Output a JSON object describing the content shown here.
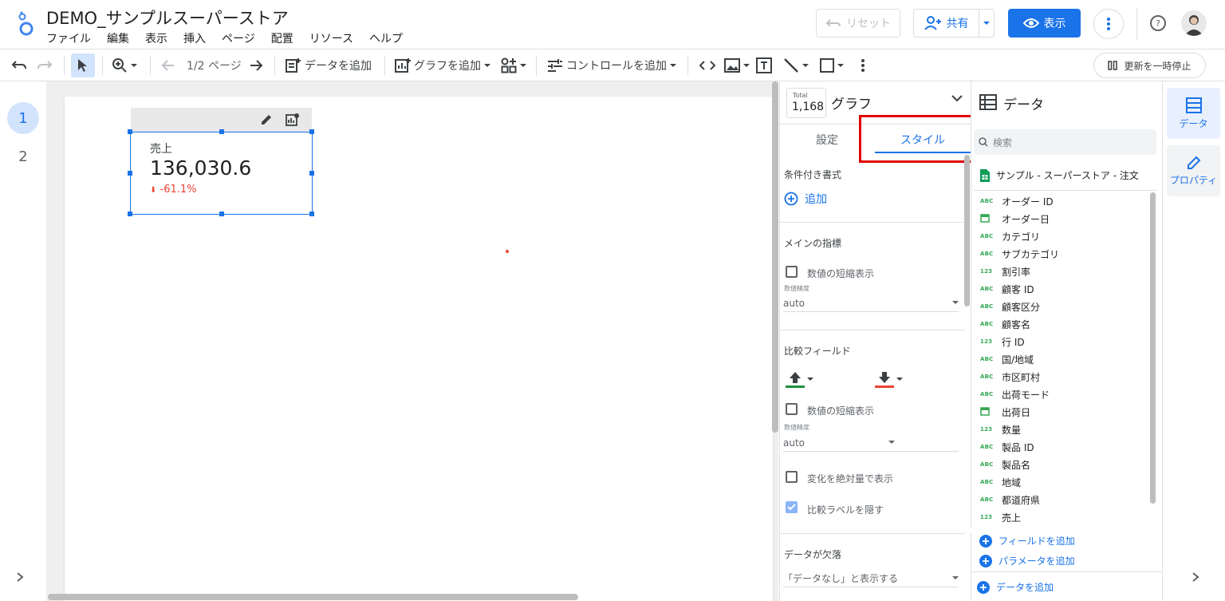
{
  "app": {
    "title": "DEMO_サンプルスーパーストア",
    "menu": [
      "ファイル",
      "編集",
      "表示",
      "挿入",
      "ページ",
      "配置",
      "リソース",
      "ヘルプ"
    ],
    "reset_label": "リセット",
    "share_label": "共有",
    "view_label": "表示"
  },
  "toolbar": {
    "page_indicator": "1/2 ページ",
    "add_data": "データを追加",
    "add_chart": "グラフを追加",
    "add_control": "コントロールを追加",
    "pause_refresh": "更新を一時停止"
  },
  "pages": [
    "1",
    "2"
  ],
  "chart": {
    "label": "売上",
    "value": "136,030.6",
    "delta": "-61.1%"
  },
  "properties": {
    "total_label": "Total",
    "total_value": "1,168",
    "chart_type": "グラフ",
    "tab_setup": "設定",
    "tab_style": "スタイル",
    "conditional_format_title": "条件付き書式",
    "add_label": "追加",
    "main_metric_title": "メインの指標",
    "compact_numbers": "数値の短縮表示",
    "precision_label": "数値精度",
    "precision_value": "auto",
    "compare_title": "比較フィールド",
    "compact_numbers_2": "数値の短縮表示",
    "precision_label_2": "数値精度",
    "precision_value_2": "auto",
    "absolute_change": "変化を絶対量で表示",
    "hide_compare_label": "比較ラベルを隠す",
    "missing_data_title": "データが欠落",
    "missing_data_value": "「データなし」と表示する",
    "colors": {
      "up": "#1e8e3e",
      "down": "#ea4335"
    }
  },
  "data_panel": {
    "title": "データ",
    "search_placeholder": "検索",
    "source_name": "サンプル - スーパーストア - 注文",
    "fields": [
      {
        "type": "ABC",
        "name": "オーダー ID"
      },
      {
        "type": "date",
        "name": "オーダー日"
      },
      {
        "type": "ABC",
        "name": "カテゴリ"
      },
      {
        "type": "ABC",
        "name": "サブカテゴリ"
      },
      {
        "type": "123",
        "name": "割引率"
      },
      {
        "type": "ABC",
        "name": "顧客 ID"
      },
      {
        "type": "ABC",
        "name": "顧客区分"
      },
      {
        "type": "ABC",
        "name": "顧客名"
      },
      {
        "type": "123",
        "name": "行 ID"
      },
      {
        "type": "ABC",
        "name": "国/地域"
      },
      {
        "type": "ABC",
        "name": "市区町村"
      },
      {
        "type": "ABC",
        "name": "出荷モード"
      },
      {
        "type": "date",
        "name": "出荷日"
      },
      {
        "type": "123",
        "name": "数量"
      },
      {
        "type": "ABC",
        "name": "製品 ID"
      },
      {
        "type": "ABC",
        "name": "製品名"
      },
      {
        "type": "ABC",
        "name": "地域"
      },
      {
        "type": "ABC",
        "name": "都道府県"
      },
      {
        "type": "123",
        "name": "売上"
      }
    ],
    "add_field": "フィールドを追加",
    "add_parameter": "パラメータを追加",
    "add_data": "データを追加"
  },
  "right_rail": {
    "data_label": "データ",
    "properties_label": "プロパティ"
  }
}
